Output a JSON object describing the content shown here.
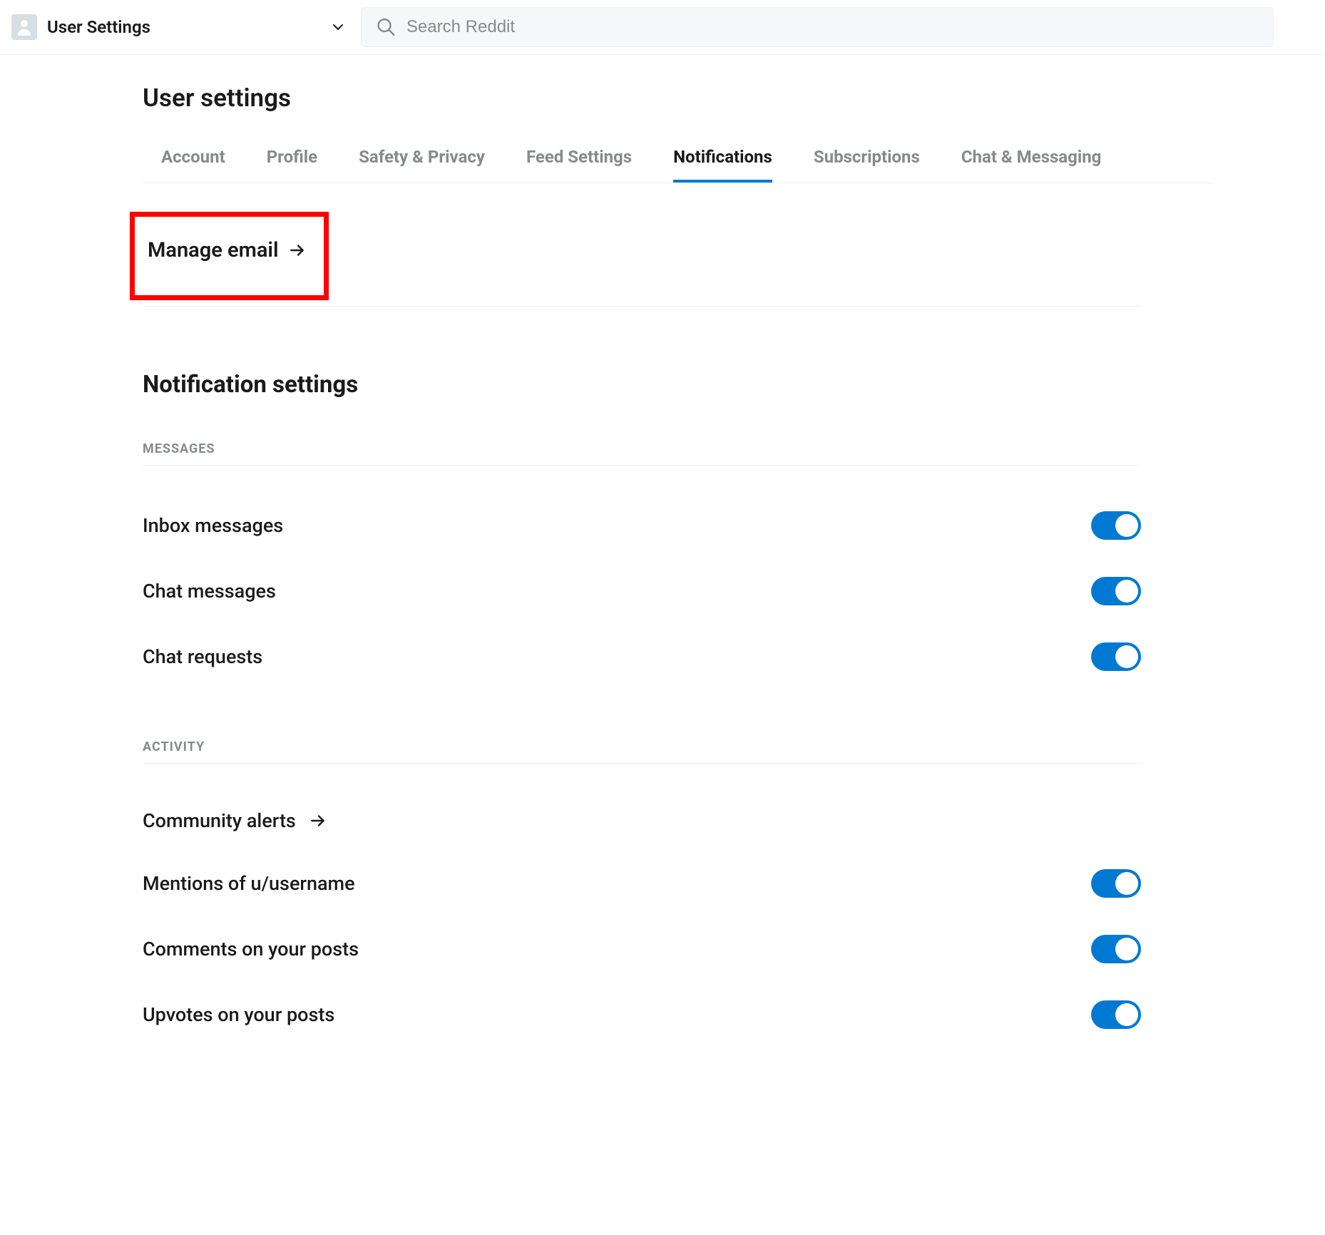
{
  "header": {
    "title": "User Settings",
    "search_placeholder": "Search Reddit"
  },
  "page": {
    "title": "User settings",
    "manage_email_label": "Manage email",
    "section_title": "Notification settings"
  },
  "tabs": [
    {
      "label": "Account",
      "active": false
    },
    {
      "label": "Profile",
      "active": false
    },
    {
      "label": "Safety & Privacy",
      "active": false
    },
    {
      "label": "Feed Settings",
      "active": false
    },
    {
      "label": "Notifications",
      "active": true
    },
    {
      "label": "Subscriptions",
      "active": false
    },
    {
      "label": "Chat & Messaging",
      "active": false
    }
  ],
  "groups": [
    {
      "label": "MESSAGES",
      "items": [
        {
          "label": "Inbox messages",
          "toggle": true
        },
        {
          "label": "Chat messages",
          "toggle": true
        },
        {
          "label": "Chat requests",
          "toggle": true
        }
      ]
    },
    {
      "label": "ACTIVITY",
      "items": [
        {
          "label": "Community alerts",
          "arrow": true
        },
        {
          "label": "Mentions of u/username",
          "toggle": true
        },
        {
          "label": "Comments on your posts",
          "toggle": true
        },
        {
          "label": "Upvotes on your posts",
          "toggle": true
        }
      ]
    }
  ]
}
